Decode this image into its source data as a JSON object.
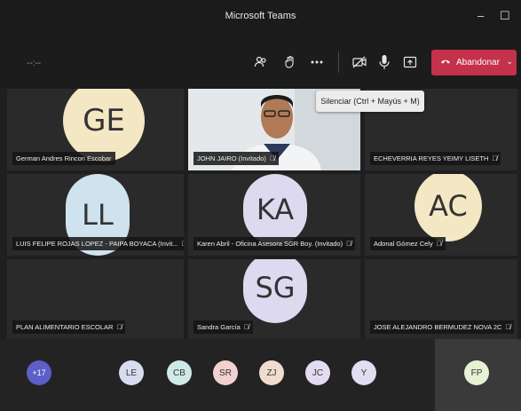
{
  "window": {
    "title": "Microsoft Teams",
    "minimize_glyph": "–",
    "maximize_glyph": "☐"
  },
  "toolbar": {
    "timer": "--:--",
    "icons": [
      "participants-icon",
      "raise-hand-icon",
      "more-options-icon",
      "camera-off-icon",
      "mic-icon",
      "share-icon"
    ],
    "leave_label": "Abandonar",
    "leave_color": "#c4314b"
  },
  "tooltip": {
    "text": "Silenciar (Ctrl + Mayús + M)"
  },
  "tiles": [
    {
      "name": "German Andres Rincon Escobar",
      "initials": "GE",
      "color": "#f4e7c3"
    },
    {
      "name": "JOHN JAIRO (Invitado)",
      "video": true
    },
    {
      "name": "ECHEVERRIA REYES YEIMY LISETH"
    },
    {
      "name": "LUIS FELIPE ROJAS LOPEZ - PAIPA BOYACA (Invit...",
      "initials": "LL",
      "color": "#cfe3ee"
    },
    {
      "name": "Karen Abril - Oficina Asesora SGR Boy. (Invitado)",
      "initials": "KA",
      "color": "#ddd9ef"
    },
    {
      "name": "Adonal Gómez Cely",
      "initials": "AC",
      "color": "#f4e7c3"
    },
    {
      "name": "PLAN ALIMENTARIO ESCOLAR"
    },
    {
      "name": "Sandra García",
      "initials": "SG",
      "color": "#ddd9ef"
    },
    {
      "name": "JOSE ALEJANDRO BERMUDEZ NOVA 2C"
    }
  ],
  "bottom_bar": {
    "more_count": "+17",
    "avatars": [
      {
        "initials": "LE",
        "color": "#d7dcf0"
      },
      {
        "initials": "CB",
        "color": "#cfe9e6"
      },
      {
        "initials": "SR",
        "color": "#f2d1d1"
      },
      {
        "initials": "ZJ",
        "color": "#f0ddd0"
      },
      {
        "initials": "JC",
        "color": "#e3dcf0"
      },
      {
        "initials": "Y",
        "color": "#e2def1"
      }
    ],
    "self": {
      "initials": "FP",
      "color": "#e7f1d3"
    }
  }
}
